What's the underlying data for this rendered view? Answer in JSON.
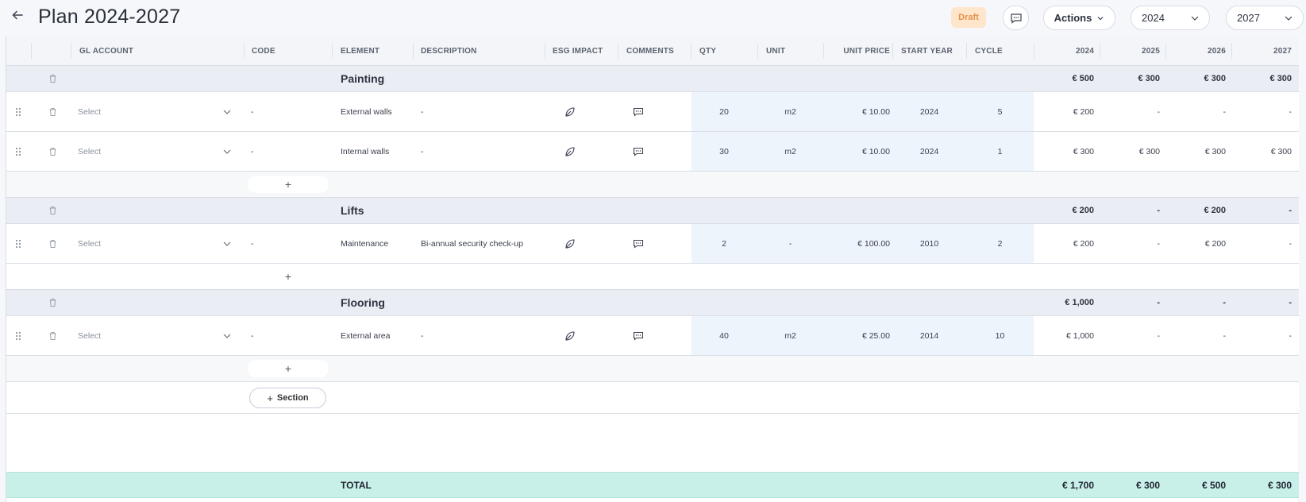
{
  "header": {
    "title": "Plan 2024-2027",
    "status": "Draft",
    "actions_label": "Actions",
    "start_year": "2024",
    "end_year": "2027"
  },
  "columns": {
    "gl_account": "GL ACCOUNT",
    "code": "CODE",
    "element": "ELEMENT",
    "description": "DESCRIPTION",
    "esg": "ESG IMPACT",
    "comments": "COMMENTS",
    "qty": "QTY",
    "unit": "UNIT",
    "unit_price": "UNIT PRICE",
    "start_year": "START YEAR",
    "cycle": "CYCLE",
    "y2024": "2024",
    "y2025": "2025",
    "y2026": "2026",
    "y2027": "2027"
  },
  "sections": [
    {
      "name": "Painting",
      "totals": [
        "€ 500",
        "€ 300",
        "€ 300",
        "€ 300"
      ],
      "items": [
        {
          "gl": "Select",
          "code": "-",
          "element": "External walls",
          "description": "-",
          "qty": "20",
          "unit": "m2",
          "unit_price": "€ 10.00",
          "start_year": "2024",
          "cycle": "5",
          "years": [
            "€ 200",
            "-",
            "-",
            "-"
          ]
        },
        {
          "gl": "Select",
          "code": "-",
          "element": "Internal walls",
          "description": "-",
          "qty": "30",
          "unit": "m2",
          "unit_price": "€ 10.00",
          "start_year": "2024",
          "cycle": "1",
          "years": [
            "€ 300",
            "€ 300",
            "€ 300",
            "€ 300"
          ]
        }
      ]
    },
    {
      "name": "Lifts",
      "totals": [
        "€ 200",
        "-",
        "€ 200",
        "-"
      ],
      "items": [
        {
          "gl": "Select",
          "code": "-",
          "element": "Maintenance",
          "description": "Bi-annual security check-up",
          "qty": "2",
          "unit": "-",
          "unit_price": "€ 100.00",
          "start_year": "2010",
          "cycle": "2",
          "years": [
            "€ 200",
            "-",
            "€ 200",
            "-"
          ]
        }
      ]
    },
    {
      "name": "Flooring",
      "totals": [
        "€ 1,000",
        "-",
        "-",
        "-"
      ],
      "items": [
        {
          "gl": "Select",
          "code": "-",
          "element": "External area",
          "description": "-",
          "qty": "40",
          "unit": "m2",
          "unit_price": "€ 25.00",
          "start_year": "2014",
          "cycle": "10",
          "years": [
            "€ 1,000",
            "-",
            "-",
            "-"
          ]
        }
      ]
    }
  ],
  "add_row_label": "+",
  "add_section_label": "Section",
  "total": {
    "label": "TOTAL",
    "values": [
      "€ 1,700",
      "€ 300",
      "€ 500",
      "€ 300"
    ]
  }
}
